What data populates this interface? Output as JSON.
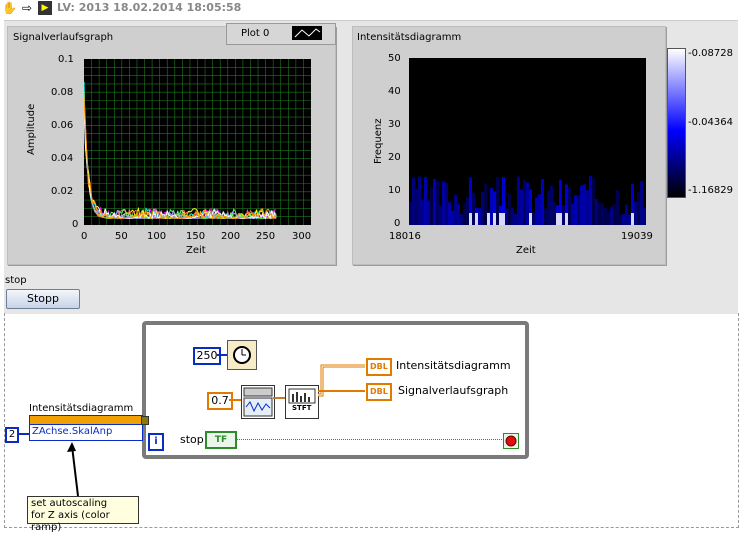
{
  "window": {
    "title": "LV: 2013 18.02.2014 18:05:58"
  },
  "front_panel": {
    "waveform_graph": {
      "label": "Signalverlaufsgraph",
      "legend_plot": "Plot 0",
      "xlabel": "Zeit",
      "ylabel": "Amplitude",
      "x_ticks": [
        "0",
        "50",
        "100",
        "150",
        "200",
        "250",
        "300"
      ],
      "y_ticks": [
        "0.1",
        "0.08",
        "0.06",
        "0.04",
        "0.02",
        "0"
      ]
    },
    "intensity_graph": {
      "label": "Intensitätsdiagramm",
      "xlabel": "Zeit",
      "ylabel": "Frequenz",
      "x_ticks": [
        "18016",
        "19039"
      ],
      "y_ticks": [
        "50",
        "40",
        "30",
        "20",
        "10",
        "0"
      ],
      "colorbar_ticks": [
        "-0.08728",
        "-0.04364",
        "-1.16829"
      ]
    },
    "stop": {
      "label": "stop",
      "button_text": "Stopp"
    }
  },
  "block_diagram": {
    "wait_ms": "250",
    "overlap": "0.7",
    "stft_label": "STFT",
    "indicator_intensity": "Intensitätsdiagramm",
    "indicator_waveform": "Signalverlaufsgraph",
    "dbl_tag": "DBL",
    "loop_iteration": "i",
    "stop_label": "stop",
    "stop_term": "TF",
    "property_node": {
      "title": "Intensitätsdiagramm",
      "property": "ZAchse.SkalAnp",
      "input_value": "2"
    },
    "comment": "set autoscaling\nfor Z axis (color ramp)"
  },
  "colors": {
    "plot_bg": "#000000",
    "grid": "#1d7a1d",
    "intensity_low": "#000000",
    "intensity_mid": "#0000ff",
    "intensity_high": "#ffffff",
    "loop_border": "#7a7a7a",
    "numeric_blue": "#0b2cc4",
    "numeric_orange": "#e07b00",
    "boolean_green": "#2d8a2d"
  }
}
